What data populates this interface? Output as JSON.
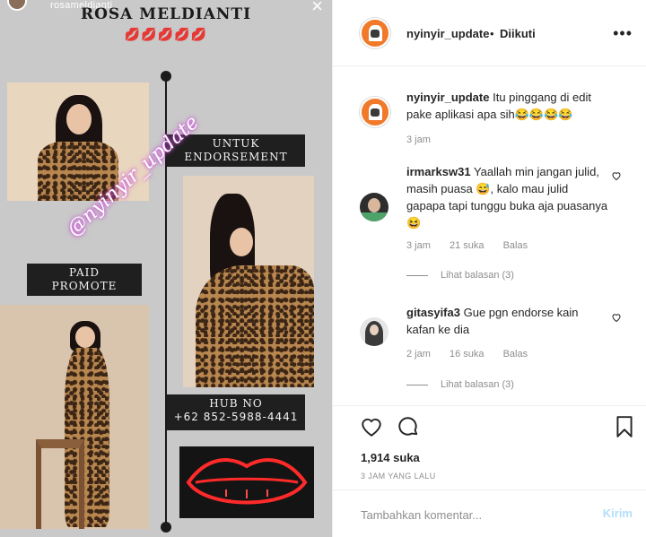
{
  "story": {
    "username": "rosameldianti",
    "close_icon": "close-icon",
    "title": "ROSA MELDIANTI",
    "emojis": "💋💋💋💋💋",
    "label_endorsement": "UNTUK\nENDORSEMENT",
    "label_paid": "PAID\nPROMOTE",
    "label_hub_title": "HUB NO",
    "label_hub_number": "+62 852-5988-4441",
    "watermark": "@nyinyir_update"
  },
  "header": {
    "username": "nyinyir_update",
    "separator": "•",
    "follow_status": "Diikuti",
    "more_icon": "more-options-icon"
  },
  "caption": {
    "username": "nyinyir_update",
    "text": "Itu pinggang di edit pake aplikasi apa sih😂😂😂😂",
    "time": "3 jam"
  },
  "comments": [
    {
      "username": "irmarksw31",
      "text": "Yaallah min jangan julid, masih puasa 😅, kalo mau julid gapapa tapi tunggu buka aja puasanya 😆",
      "time": "3 jam",
      "likes": "21 suka",
      "reply_label": "Balas",
      "view_replies": "Lihat balasan (3)"
    },
    {
      "username": "gitasyifa3",
      "text": "Gue pgn endorse kain kafan ke dia",
      "time": "2 jam",
      "likes": "16 suka",
      "reply_label": "Balas",
      "view_replies": "Lihat balasan (3)"
    }
  ],
  "actions": {
    "like_icon": "heart-icon",
    "comment_icon": "comment-icon",
    "save_icon": "bookmark-icon",
    "likes_count": "1,914 suka",
    "time_ago": "3 JAM YANG LALU"
  },
  "comment_box": {
    "placeholder": "Tambahkan komentar...",
    "post_label": "Kirim"
  },
  "colors": {
    "link_disabled": "#b2dffc",
    "muted_text": "#8e8e8e",
    "avatar_orange": "#f07a2a",
    "neon_red": "#ff2a2a"
  }
}
